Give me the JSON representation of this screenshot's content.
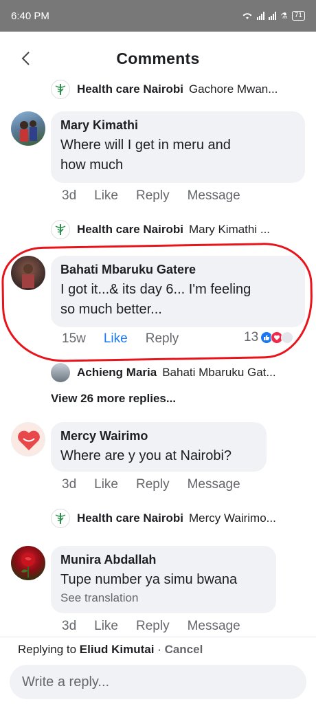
{
  "status": {
    "time": "6:40 PM",
    "battery": "71"
  },
  "header": {
    "title": "Comments",
    "back_icon": "back-arrow-icon"
  },
  "thread": {
    "top_reply": {
      "name": "Health care Nairobi",
      "preview": "Gachore Mwan..."
    },
    "comments": [
      {
        "author": "Mary Kimathi",
        "text_lines": [
          "Where  will I get in meru and",
          "how much"
        ],
        "time": "3d",
        "like": "Like",
        "reply": "Reply",
        "message": "Message",
        "reply_preview": {
          "name": "Health care Nairobi",
          "preview": "Mary Kimathi ..."
        }
      },
      {
        "author": "Bahati Mbaruku Gatere",
        "text_lines": [
          "I got it...& its day 6... I'm feeling",
          "so much better..."
        ],
        "time": "15w",
        "like": "Like",
        "reply": "Reply",
        "reaction_count": "13",
        "reply_preview": {
          "name": "Achieng Maria",
          "preview": "Bahati Mbaruku Gat..."
        },
        "more_replies": "View 26 more replies..."
      },
      {
        "author": "Mercy Wairimo",
        "text_lines": [
          "Where are y you at Nairobi?"
        ],
        "time": "3d",
        "like": "Like",
        "reply": "Reply",
        "message": "Message",
        "reply_preview": {
          "name": "Health care Nairobi",
          "preview": "Mercy Wairimo..."
        }
      },
      {
        "author": "Munira Abdallah",
        "text_lines": [
          "Tupe number ya simu bwana"
        ],
        "see_translation": "See translation",
        "time": "3d",
        "like": "Like",
        "reply": "Reply",
        "message": "Message"
      }
    ]
  },
  "footer": {
    "replying_prefix": "Replying to",
    "replying_to": "Eliud Kimutai",
    "separator": "·",
    "cancel": "Cancel",
    "input_placeholder": "Write a reply..."
  },
  "colors": {
    "accent": "#1877f2",
    "highlight": "#e8141c",
    "bubble": "#f0f2f5",
    "status_bar": "#787878"
  }
}
